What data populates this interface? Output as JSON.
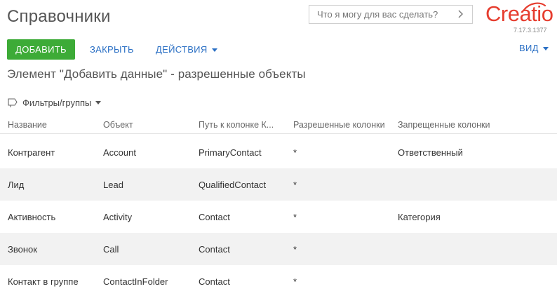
{
  "header": {
    "title": "Справочники",
    "search_placeholder": "Что я могу для вас сделать?",
    "logo_text": "Creatio",
    "version": "7.17.3.1377",
    "brand_color": "#e63d2f"
  },
  "toolbar": {
    "add_label": "ДОБАВИТЬ",
    "close_label": "ЗАКРЫТЬ",
    "actions_label": "ДЕЙСТВИЯ",
    "view_label": "ВИД",
    "accent_color": "#3dab37",
    "link_color": "#2a6fc4"
  },
  "subtitle": "Элемент \"Добавить данные\" - разрешенные объекты",
  "filters": {
    "label": "Фильтры/группы"
  },
  "grid": {
    "columns": [
      "Название",
      "Объект",
      "Путь к колонке К...",
      "Разрешенные колонки",
      "Запрещенные колонки"
    ],
    "rows": [
      [
        "Контрагент",
        "Account",
        "PrimaryContact",
        "*",
        "Ответственный"
      ],
      [
        "Лид",
        "Lead",
        "QualifiedContact",
        "*",
        ""
      ],
      [
        "Активность",
        "Activity",
        "Contact",
        "*",
        "Категория"
      ],
      [
        "Звонок",
        "Call",
        "Contact",
        "*",
        ""
      ],
      [
        "Контакт в группе",
        "ContactInFolder",
        "Contact",
        "*",
        ""
      ]
    ]
  }
}
